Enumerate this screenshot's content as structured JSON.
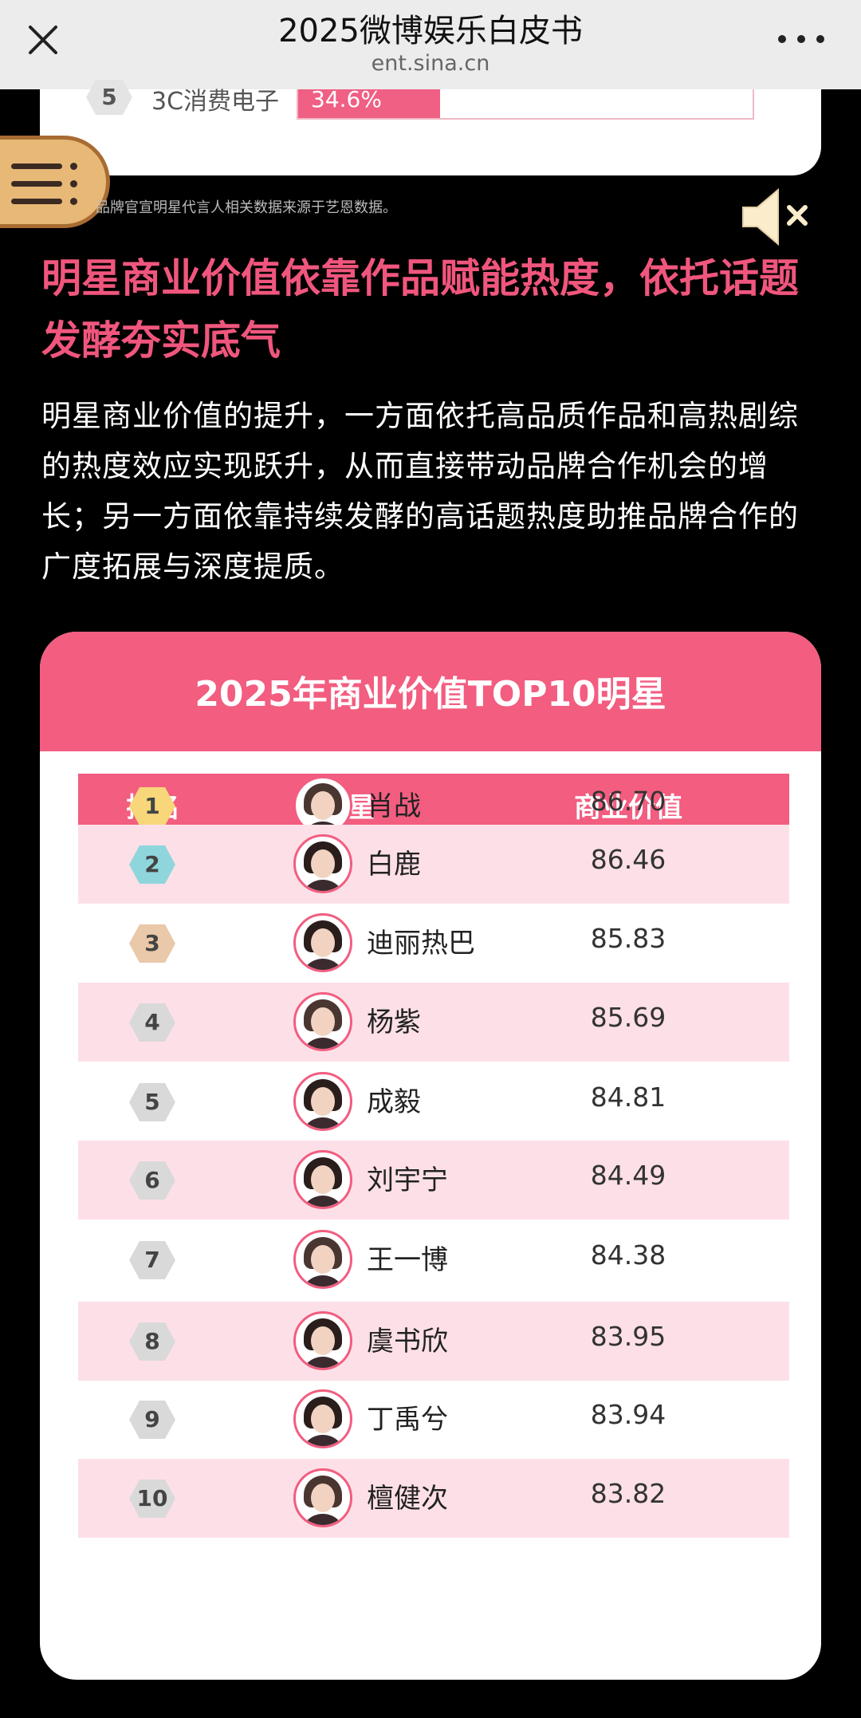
{
  "browser": {
    "title": "2025微博娱乐白皮书",
    "url": "ent.sina.cn",
    "close_icon": "close-icon",
    "more_icon": "more-dots-icon"
  },
  "previous_section": {
    "rank": "5",
    "label": "3C消费电子",
    "bar_value": "34.6%",
    "bar_fraction": 0.346,
    "source_note": "品牌官宣明星代言人相关数据来源于艺恩数据。"
  },
  "floating": {
    "menu_icon": "menu-list-icon",
    "sound_icon": "speaker-muted-icon"
  },
  "article": {
    "headline": "明星商业价值依靠作品赋能热度，依托话题发酵夯实底气",
    "paragraph": "明星商业价值的提升，一方面依托高品质作品和高热剧综的热度效应实现跃升，从而直接带动品牌合作机会的增长；另一方面依靠持续发酵的高话题热度助推品牌合作的广度拓展与深度提质。"
  },
  "ranking": {
    "title": "2025年商业价值TOP10明星",
    "columns": {
      "rank": "排名",
      "star": "明星",
      "value": "商业价值"
    },
    "colors": {
      "accent": "#f25d80",
      "alt_row": "#fde0e7",
      "gold": "#f7d77a",
      "silver": "#8fd6dc",
      "bronze": "#e9c9a9",
      "grey": "#d9d9d9"
    },
    "rows": [
      {
        "rank": "1",
        "name": "肖战",
        "value": "86.70"
      },
      {
        "rank": "2",
        "name": "白鹿",
        "value": "86.46"
      },
      {
        "rank": "3",
        "name": "迪丽热巴",
        "value": "85.83"
      },
      {
        "rank": "4",
        "name": "杨紫",
        "value": "85.69"
      },
      {
        "rank": "5",
        "name": "成毅",
        "value": "84.81"
      },
      {
        "rank": "6",
        "name": "刘宇宁",
        "value": "84.49"
      },
      {
        "rank": "7",
        "name": "王一博",
        "value": "84.38"
      },
      {
        "rank": "8",
        "name": "虞书欣",
        "value": "83.95"
      },
      {
        "rank": "9",
        "name": "丁禹兮",
        "value": "83.94"
      },
      {
        "rank": "10",
        "name": "檀健次",
        "value": "83.82"
      }
    ]
  }
}
